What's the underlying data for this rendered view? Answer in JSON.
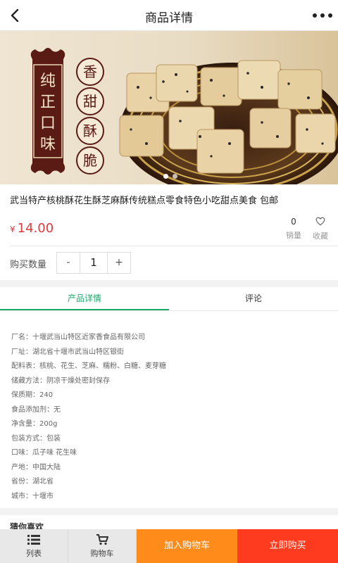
{
  "header": {
    "title": "商品详情"
  },
  "banner": {
    "seal_text": "纯正口味",
    "badges": [
      "香",
      "甜",
      "酥",
      "脆"
    ]
  },
  "product": {
    "name": "武当特产核桃酥花生酥芝麻酥传统糕点零食特色小吃甜点美食 包邮",
    "currency": "¥",
    "price": "14.00",
    "sales_count": "0",
    "sales_label": "销量",
    "favorite_label": "收藏"
  },
  "purchase": {
    "quantity_label": "购买数量",
    "minus": "-",
    "quantity": "1",
    "plus": "+"
  },
  "tabs": [
    {
      "label": "产品详情"
    },
    {
      "label": "评论"
    }
  ],
  "details": [
    "厂名：十堰武当山特区近家香食品有限公司",
    "厂址：湖北省十堰市武当山特区银街",
    "配料表：核桃、花生、芝麻、糯粉、白糖、麦芽糖",
    "储藏方法：阴凉干燥处密封保存",
    "保质期：240",
    "食品添加剂：无",
    "净含量：200g",
    "包装方式：包装",
    "口味：瓜子味 花生味",
    "产地：中国大陆",
    "省份：湖北省",
    "城市：十堰市"
  ],
  "more_heading": "猜你喜欢",
  "bottom_bar": {
    "list_label": "列表",
    "cart_label": "购物车",
    "add_to_cart": "加入购物车",
    "buy_now": "立即购买"
  },
  "colors": {
    "accent_green": "#1aa86a",
    "price_red": "#e4393c",
    "cart_orange": "#ff8c1a",
    "buy_red": "#ff3b1f",
    "seal_brown": "#5a1b14"
  }
}
